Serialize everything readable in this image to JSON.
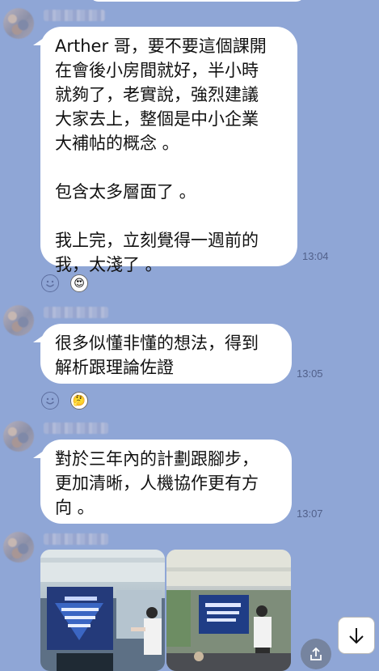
{
  "messages": [
    {
      "sender_name": "██████",
      "text": "Arther 哥，要不要這個課開\n在會後小房間就好，半小時\n就夠了，老實說，強烈建議\n大家去上，整個是中小企業\n大補帖的概念 。\n\n包含太多層面了 。\n\n我上完，立刻覺得一週前的\n我，太淺了 。",
      "time": "13:04",
      "reaction_icon": "heart-eyes-emoji-icon",
      "reaction_glyph": "😍"
    },
    {
      "sender_name": "██████",
      "text": "很多似懂非懂的想法，得到\n解析跟理論佐證",
      "time": "13:05",
      "reaction_icon": "thinking-emoji-icon",
      "reaction_glyph": "🤔"
    },
    {
      "sender_name": "██████",
      "text": "對於三年內的計劃跟腳步，\n更加清晰，人機協作更有方\n向 。",
      "time": "13:07"
    },
    {
      "sender_name": "██████",
      "photos": [
        "presentation-photo",
        "presentation-photo"
      ]
    }
  ],
  "icons": {
    "add_reaction": "smiley-add-reaction-icon",
    "share": "share-icon",
    "scroll_down": "arrow-down-icon"
  },
  "colors": {
    "chat_background": "#8fa6d6",
    "bubble": "#ffffff",
    "timestamp": "#51608a"
  }
}
